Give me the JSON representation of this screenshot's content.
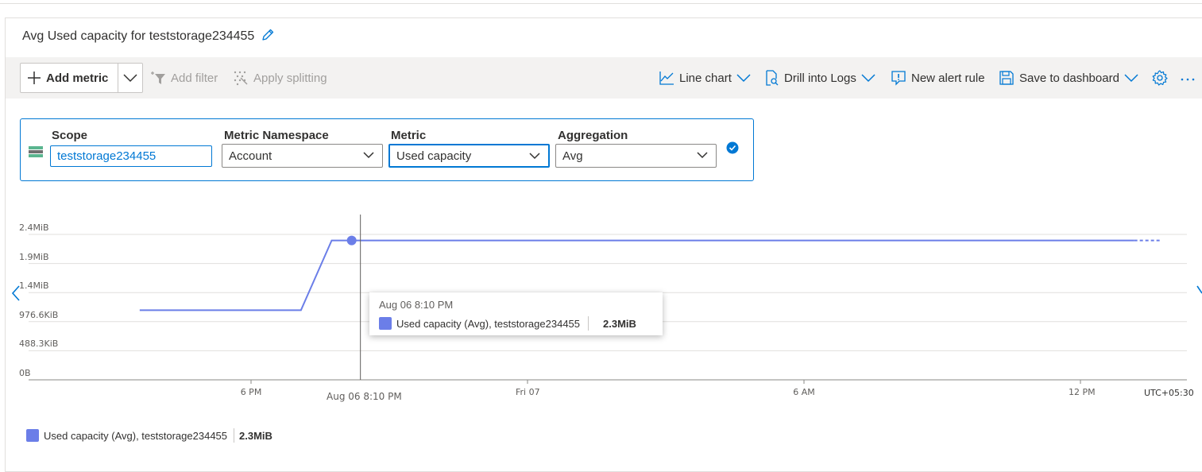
{
  "title": "Avg Used capacity for teststorage234455",
  "toolbar": {
    "add_metric": "Add metric",
    "add_filter": "Add filter",
    "apply_splitting": "Apply splitting",
    "line_chart": "Line chart",
    "drill_into_logs": "Drill into Logs",
    "new_alert_rule": "New alert rule",
    "save_to_dashboard": "Save to dashboard"
  },
  "scope_row": {
    "scope_label": "Scope",
    "scope_value": "teststorage234455",
    "namespace_label": "Metric Namespace",
    "namespace_value": "Account",
    "metric_label": "Metric",
    "metric_value": "Used capacity",
    "aggregation_label": "Aggregation",
    "aggregation_value": "Avg"
  },
  "colors": {
    "accent": "#0078d4",
    "series": "#6b7ee8"
  },
  "chart_data": {
    "type": "line",
    "y_ticks": [
      "0B",
      "488.3KiB",
      "976.6KiB",
      "1.4MiB",
      "1.9MiB",
      "2.4MiB"
    ],
    "x_ticks": [
      "6 PM",
      "Fri 07",
      "6 AM",
      "12 PM"
    ],
    "x_cursor_label": "Aug 06 8:10 PM",
    "timezone": "UTC+05:30",
    "ylim_mib": [
      0,
      2.4
    ],
    "series": [
      {
        "name": "Used capacity (Avg), teststorage234455",
        "points": [
          {
            "x": "Aug 06 3:35 PM",
            "y_mib": 1.15
          },
          {
            "x": "Aug 06 7:05 PM",
            "y_mib": 1.15
          },
          {
            "x": "Aug 06 8:10 PM",
            "y_mib": 2.3
          },
          {
            "x": "Aug 07 1:10 PM",
            "y_mib": 2.3
          }
        ]
      }
    ],
    "tooltip": {
      "time": "Aug 06 8:10 PM",
      "series": "Used capacity (Avg), teststorage234455",
      "value": "2.3MiB"
    },
    "legend": {
      "series": "Used capacity (Avg), teststorage234455",
      "value": "2.3MiB",
      "placement": "bottom-left"
    }
  }
}
